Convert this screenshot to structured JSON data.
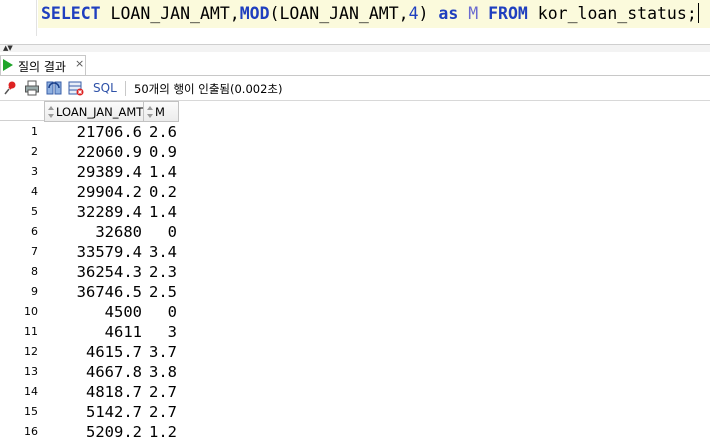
{
  "editor": {
    "tokens": [
      {
        "text": "SELECT",
        "cls": "kw"
      },
      {
        "text": " ",
        "cls": "id"
      },
      {
        "text": "LOAN_JAN_AMT",
        "cls": "id"
      },
      {
        "text": ",",
        "cls": "pn"
      },
      {
        "text": "MOD",
        "cls": "fn"
      },
      {
        "text": "(",
        "cls": "pn"
      },
      {
        "text": "LOAN_JAN_AMT",
        "cls": "id"
      },
      {
        "text": ",",
        "cls": "pn"
      },
      {
        "text": "4",
        "cls": "num"
      },
      {
        "text": ")",
        "cls": "pn"
      },
      {
        "text": " ",
        "cls": "id"
      },
      {
        "text": "as",
        "cls": "kw"
      },
      {
        "text": " ",
        "cls": "id"
      },
      {
        "text": "M",
        "cls": "al"
      },
      {
        "text": " ",
        "cls": "id"
      },
      {
        "text": "FROM",
        "cls": "kw"
      },
      {
        "text": " ",
        "cls": "id"
      },
      {
        "text": "kor_loan_status",
        "cls": "id"
      },
      {
        "text": ";",
        "cls": "pn"
      }
    ]
  },
  "result_tab": {
    "label": "질의 결과",
    "close": "×"
  },
  "toolbar": {
    "sql_label": "SQL",
    "status": "50개의 행이 인출됨(0.002초)",
    "icons": [
      "pin-icon",
      "print-icon",
      "refresh-icon",
      "export-icon"
    ]
  },
  "grid": {
    "columns": [
      "LOAN_JAN_AMT",
      "M"
    ],
    "rows": [
      {
        "num": "1",
        "amt": "21706.6",
        "m": "2.6"
      },
      {
        "num": "2",
        "amt": "22060.9",
        "m": "0.9"
      },
      {
        "num": "3",
        "amt": "29389.4",
        "m": "1.4"
      },
      {
        "num": "4",
        "amt": "29904.2",
        "m": "0.2"
      },
      {
        "num": "5",
        "amt": "32289.4",
        "m": "1.4"
      },
      {
        "num": "6",
        "amt": "32680",
        "m": "0"
      },
      {
        "num": "7",
        "amt": "33579.4",
        "m": "3.4"
      },
      {
        "num": "8",
        "amt": "36254.3",
        "m": "2.3"
      },
      {
        "num": "9",
        "amt": "36746.5",
        "m": "2.5"
      },
      {
        "num": "10",
        "amt": "4500",
        "m": "0"
      },
      {
        "num": "11",
        "amt": "4611",
        "m": "3"
      },
      {
        "num": "12",
        "amt": "4615.7",
        "m": "3.7"
      },
      {
        "num": "13",
        "amt": "4667.8",
        "m": "3.8"
      },
      {
        "num": "14",
        "amt": "4818.7",
        "m": "2.7"
      },
      {
        "num": "15",
        "amt": "5142.7",
        "m": "2.7"
      },
      {
        "num": "16",
        "amt": "5209.2",
        "m": "1.2"
      }
    ]
  },
  "colors": {
    "keyword": "#1f3fbf",
    "alias": "#6a6ad0",
    "current_line": "#fbfadc",
    "run_icon": "#1fa52a",
    "sql_link": "#2f52a8"
  }
}
